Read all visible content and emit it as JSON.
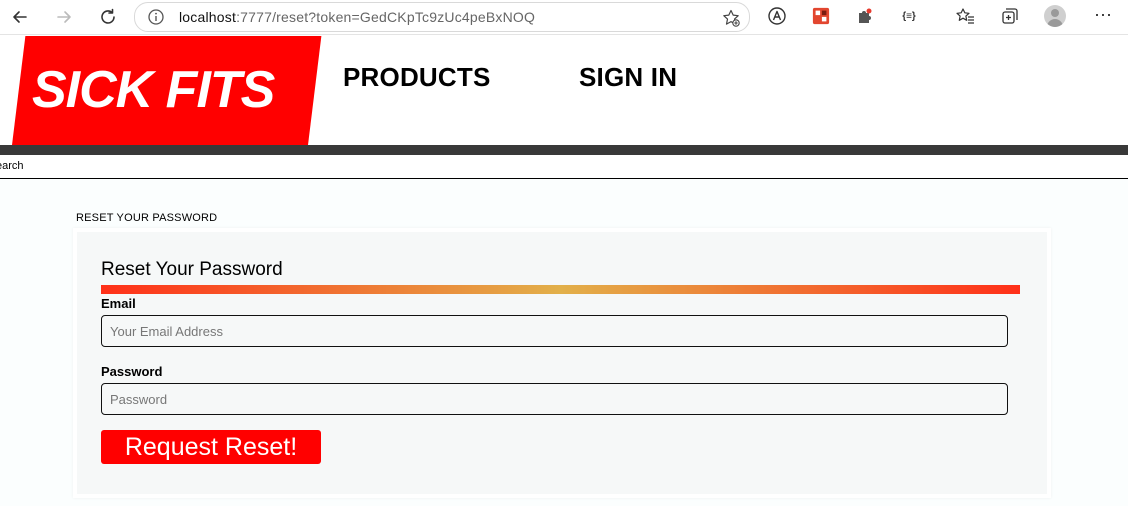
{
  "browser": {
    "url_host": "localhost",
    "url_rest": ":7777/reset?token=GedCKpTc9zUc4peBxNOQ",
    "extension_text_icon": "{≡}",
    "icons": [
      "back-icon",
      "forward-icon",
      "reload-icon",
      "info-icon",
      "add-favorite-icon",
      "read-aloud-icon",
      "extension-icon",
      "puzzle-icon",
      "json-icon",
      "favorites-icon",
      "collections-icon",
      "profile-icon",
      "more-icon"
    ]
  },
  "header": {
    "logo": "SICK FITS",
    "nav": [
      "PRODUCTS",
      "SIGN IN"
    ]
  },
  "search": {
    "label": "earch"
  },
  "page": {
    "section_title": "RESET YOUR PASSWORD",
    "form": {
      "title": "Reset Your Password",
      "email_label": "Email",
      "email_placeholder": "Your Email Address",
      "password_label": "Password",
      "password_placeholder": "Password",
      "submit_label": "Request Reset!"
    }
  },
  "colors": {
    "brand_red": "#ff0000",
    "header_bar": "#393939",
    "gradient_start": "#ff3019",
    "gradient_mid": "#e2b04a"
  }
}
